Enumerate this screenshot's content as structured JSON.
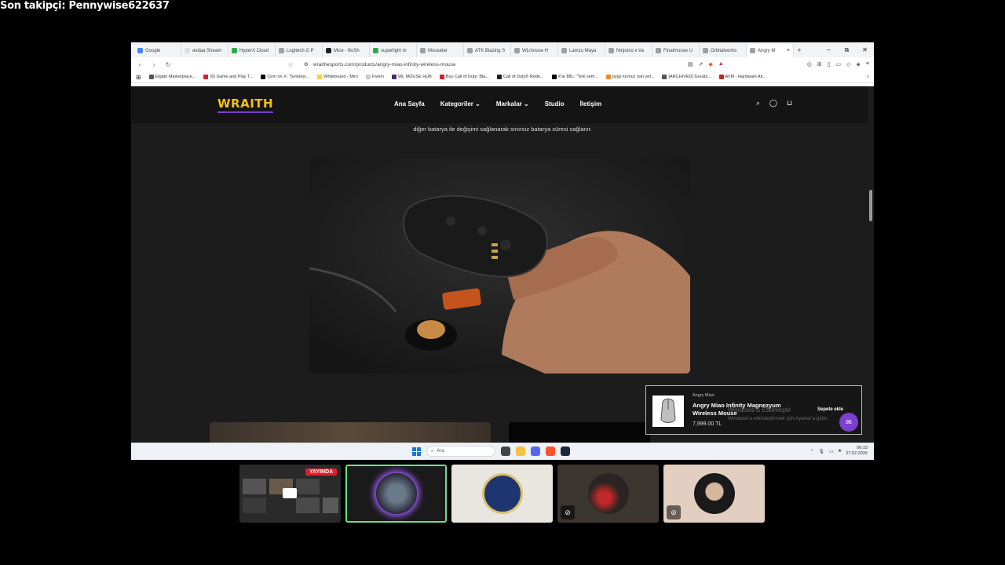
{
  "overlay": {
    "last_follower": "Son takipçi: Pennywise622637"
  },
  "browser": {
    "tabs": [
      {
        "label": "Google",
        "color": "#4285f4"
      },
      {
        "label": "avdaa Stream",
        "color": "#dddddd"
      },
      {
        "label": "HyperX Cloud",
        "color": "#2aa84a"
      },
      {
        "label": "Logitech G P",
        "color": "#9aa0a6"
      },
      {
        "label": "Mice - BoSh",
        "color": "#222222"
      },
      {
        "label": "superlight m",
        "color": "#2aa84a"
      },
      {
        "label": "Mouselar",
        "color": "#9aa0a6"
      },
      {
        "label": "ATK Blazing S",
        "color": "#9aa0a6"
      },
      {
        "label": "WLmouse H",
        "color": "#9aa0a6"
      },
      {
        "label": "Lamzu Maya",
        "color": "#9aa0a6"
      },
      {
        "label": "Ninjutso x Va",
        "color": "#9aa0a6"
      },
      {
        "label": "Finalmouse U",
        "color": "#9aa0a6"
      },
      {
        "label": "Orbitalworks",
        "color": "#9aa0a6"
      },
      {
        "label": "Angry M",
        "color": "#9aa0a6",
        "active": true
      }
    ],
    "new_tab": "+",
    "window_controls": [
      "–",
      "⧉",
      "✕"
    ],
    "url": "wraithesports.com/products/angry-miao-infinity-wireless-mouse",
    "bookmarks": [
      {
        "label": "Elgato Marketplace...",
        "color": "#555555"
      },
      {
        "label": "(6) Game and Play T...",
        "color": "#e11d2a"
      },
      {
        "label": "Cem on X: \"Sendeyi...",
        "color": "#000000"
      },
      {
        "label": "Whiteboard - Miro",
        "color": "#ffd02f"
      },
      {
        "label": "Fivem",
        "color": "#cccccc"
      },
      {
        "label": "WL MOUSE HUB",
        "color": "#4b2a7a"
      },
      {
        "label": "Buy Call of Duty: Bla...",
        "color": "#e11d2a"
      },
      {
        "label": "Call of Duty® Rede...",
        "color": "#222222"
      },
      {
        "label": "X'te 88L: \"Tetil sem...",
        "color": "#000000"
      },
      {
        "label": "pygx kırmızı yan yef...",
        "color": "#f08a24"
      },
      {
        "label": "[ARCHIVED] Greats...",
        "color": "#555555"
      },
      {
        "label": "AVM - Hardware An...",
        "color": "#cc2222"
      }
    ],
    "bookmarks_more": "»"
  },
  "site": {
    "logo": "WRAITH",
    "menu": [
      "Ana Sayfa",
      "Kategoriler ⌄",
      "Markalar ⌄",
      "Studio",
      "İletişim"
    ],
    "description": "diğer batarya ile değişimi sağlanarak sınırsız batarya süresi sağlanır.",
    "cart_popup": {
      "brand": "Angry Miao",
      "product": "Angry Miao Infinity Magnezyum Wireless Mouse",
      "price": "7,999.00 TL",
      "button": "Sepete ekle"
    },
    "watermark": {
      "line1": "Windows'u Etkinleştir",
      "line2": "Windows'u etkinleştirmek için Ayarlar'a gidin."
    }
  },
  "taskbar": {
    "search_placeholder": "Ara",
    "time": "06:15",
    "date": "27.02.2026"
  },
  "cams": {
    "live_label": "YAYINDA"
  }
}
